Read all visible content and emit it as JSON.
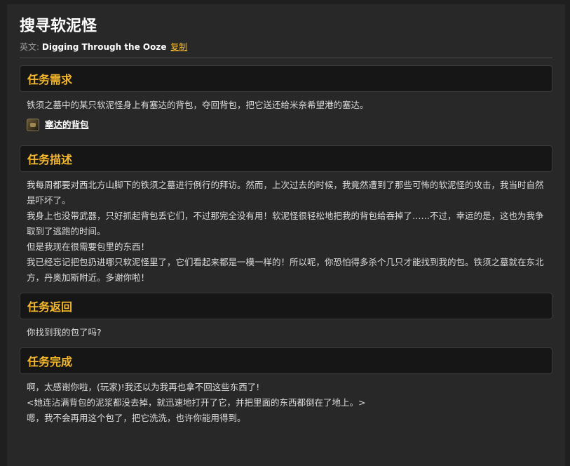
{
  "quest": {
    "title": "搜寻软泥怪",
    "en_label": "英文:",
    "en_name": "Digging Through the Ooze",
    "copy_label": "复制"
  },
  "sections": {
    "requirement": {
      "heading": "任务需求",
      "text": "铁须之墓中的某只软泥怪身上有塞达的背包，夺回背包，把它送还给米奈希望港的塞达。",
      "item_label": "塞达的背包",
      "item_icon": "bag-icon"
    },
    "description": {
      "heading": "任务描述",
      "lines": [
        "我每周都要对西北方山脚下的铁须之墓进行例行的拜访。然而，上次过去的时候，我竟然遭到了那些可怖的软泥怪的攻击，我当时自然是吓坏了。",
        "我身上也没带武器，只好抓起背包丢它们，不过那完全没有用！软泥怪很轻松地把我的背包给吞掉了……不过，幸运的是，这也为我争取到了逃跑的时间。",
        "但是我现在很需要包里的东西！",
        "我已经忘记把包扔进哪只软泥怪里了，它们看起来都是一模一样的！所以呢，你恐怕得多杀个几只才能找到我的包。铁须之墓就在东北方，丹奥加斯附近。多谢你啦！"
      ]
    },
    "return": {
      "heading": "任务返回",
      "text": "你找到我的包了吗?"
    },
    "complete": {
      "heading": "任务完成",
      "lines": [
        "啊，太感谢你啦，(玩家)!我还以为我再也拿不回这些东西了!",
        "<她连沾满背包的泥浆都没去掉，就迅速地打开了它，并把里面的东西都倒在了地上。>",
        "嗯，我不会再用这个包了，把它洗洗，也许你能用得到。"
      ]
    }
  },
  "colors": {
    "accent": "#f5b82e",
    "background": "#282828",
    "section_header_bg": "#161616"
  }
}
